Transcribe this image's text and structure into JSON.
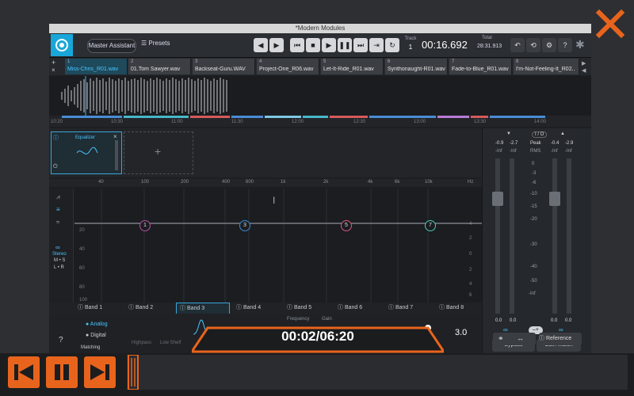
{
  "app": {
    "title": "*Modern Modules"
  },
  "toolbar": {
    "master_assistant": "Master Assistant",
    "presets": "Presets",
    "track_label": "Track",
    "track_num": "1",
    "time": "00:16.692",
    "total_label": "Total",
    "total_time": "28:31.913"
  },
  "tabs": [
    {
      "num": "1",
      "name": "Miss-Chris_R01.wav"
    },
    {
      "num": "2",
      "name": "01.Tom Sawyer.wav"
    },
    {
      "num": "3",
      "name": "Backseat-Guru.WAV"
    },
    {
      "num": "4",
      "name": "Project-One_R06.wav"
    },
    {
      "num": "5",
      "name": "Let-It-Ride_R01.wav"
    },
    {
      "num": "6",
      "name": "Synthonaught-R01.wav"
    },
    {
      "num": "7",
      "name": "Fade-to-Blue_R01.wav"
    },
    {
      "num": "8",
      "name": "I'm-Not-Feeling-It_R02..."
    }
  ],
  "timeline": {
    "ticks": [
      "10:20",
      "10:30",
      "11:00",
      "11:30",
      "12:00",
      "12:30",
      "13:00",
      "13:30",
      "14:00"
    ]
  },
  "module": {
    "name": "Equalizer",
    "add_symbol": "+"
  },
  "eq": {
    "freq_labels": [
      "40",
      "100",
      "200",
      "400",
      "600",
      "1k",
      "2k",
      "4k",
      "6k",
      "10k",
      "Hz"
    ],
    "db_left": [
      "20",
      "40",
      "60",
      "80",
      "100"
    ],
    "db_right": [
      "4",
      "2",
      "0",
      "2",
      "4",
      "6",
      "8"
    ],
    "nodes": [
      "1",
      "3",
      "5",
      "7"
    ],
    "stereo": "Stereo",
    "ms": "M • S",
    "lr": "L • R"
  },
  "bands": [
    "Band 1",
    "Band 2",
    "Band 3",
    "Band 4",
    "Band 5",
    "Band 6",
    "Band 7",
    "Band 8"
  ],
  "bottom": {
    "analog": "Analog",
    "digital": "Digital",
    "matching": "Matching",
    "highpass": "Highpass",
    "lowshelf": "Low Shelf",
    "bell": "Bell",
    "frequency": "Frequency",
    "gain": "Gain",
    "gain_value": "3.0",
    "help": "?"
  },
  "meters": {
    "io": "I / O",
    "peak": "Peak",
    "rms": "RMS",
    "left_peak": [
      "-0.9",
      "-2.7"
    ],
    "left_inf": [
      "-Inf",
      "-Inf"
    ],
    "right_peak": [
      "-0.4",
      "-2.9"
    ],
    "right_inf": [
      "-Inf",
      "-Inf"
    ],
    "scale": [
      "0",
      "-3",
      "-6",
      "-10",
      "-15",
      "-20",
      "-30",
      "-40",
      "-50",
      "-Inf"
    ],
    "in_vals": [
      "0.0",
      "0.0"
    ],
    "out_vals": [
      "0.0",
      "0.0"
    ],
    "bypass": "Bypass",
    "gain_match": "Gain Match",
    "reference": "Reference"
  },
  "player": {
    "time": "00:02/06:20",
    "progress": 0.0
  }
}
